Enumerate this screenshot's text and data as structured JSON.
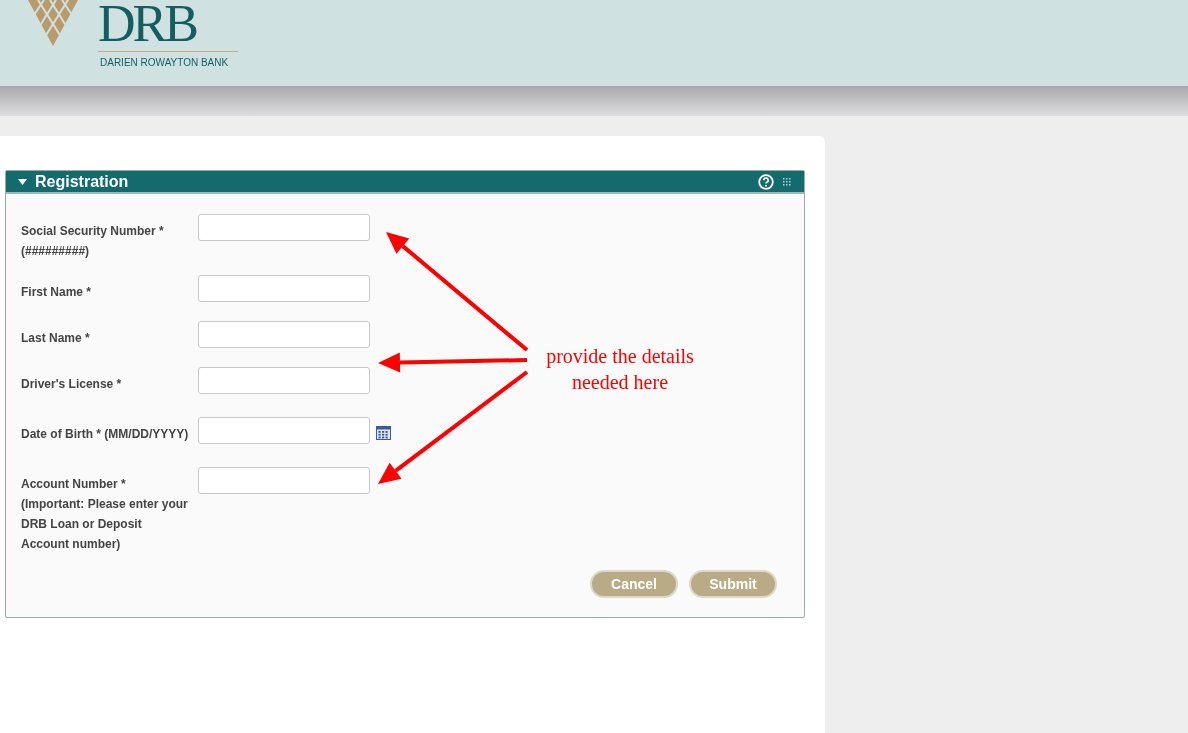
{
  "header": {
    "logo_text": "DRB",
    "bank_name": "DARIEN ROWAYTON BANK"
  },
  "panel": {
    "title": "Registration",
    "expanded": true
  },
  "fields": [
    {
      "kind": "text",
      "label": "Social Security Number *",
      "hint": "(#########)"
    },
    {
      "kind": "text",
      "label": "First Name *"
    },
    {
      "kind": "text",
      "label": "Last Name *"
    },
    {
      "kind": "text",
      "label": "Driver's License *"
    },
    {
      "kind": "date",
      "label": "Date of Birth * (MM/DD/YYYY)"
    },
    {
      "kind": "text",
      "label": "Account Number * (Important: Please enter your DRB Loan or Deposit Account number)"
    }
  ],
  "buttons": [
    "Cancel",
    "Submit"
  ],
  "annotation": {
    "lines": [
      "provide the details",
      "needed here"
    ]
  }
}
